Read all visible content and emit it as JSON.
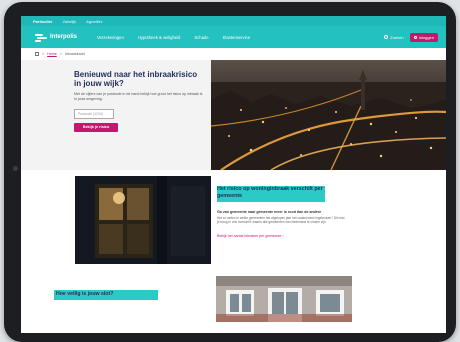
{
  "utility_nav": [
    "Particulier",
    "Zakelijk",
    "Agrariërs"
  ],
  "brand": {
    "name": "Interpolis",
    "accent": "#23c1bf",
    "cta_color": "#c4186f",
    "title_color": "#1f2d5c"
  },
  "main_nav": [
    "Verzekeringen",
    "Hypotheek & veiligheid",
    "Schade",
    "Klantenservice"
  ],
  "search": {
    "label": "Zoeken"
  },
  "login": {
    "label": "Inloggen"
  },
  "breadcrumb": {
    "home": "Home",
    "current": "Inbraakkaart"
  },
  "hero": {
    "title": "Benieuwd naar het inbraakrisico in jouw wijk?",
    "text": "Met de cijfers van je postcode in de hand bekijk hoe groot het risico op inbraak is in jouw omgeving.",
    "postcode_placeholder": "Postcode (1234)",
    "cta": "Bekijk je risico"
  },
  "risk_section": {
    "title": "Het risico op woninginbraak verschilt per gemeente",
    "subtitle": "Ga van gemeente naar gemeente meer in rood dan de andere",
    "text": "Het zo weten in welke gemeenten het afgelopen jaar het vaakst werd ingebroken? Dit vind je terug in ons overzicht, waarin alle gemeenten van Nederland te vinden zijn.",
    "link": "Bekijk het aantal inbraken per gemeente"
  },
  "safety_section": {
    "title": "Hoe veilig is jouw slot?"
  }
}
